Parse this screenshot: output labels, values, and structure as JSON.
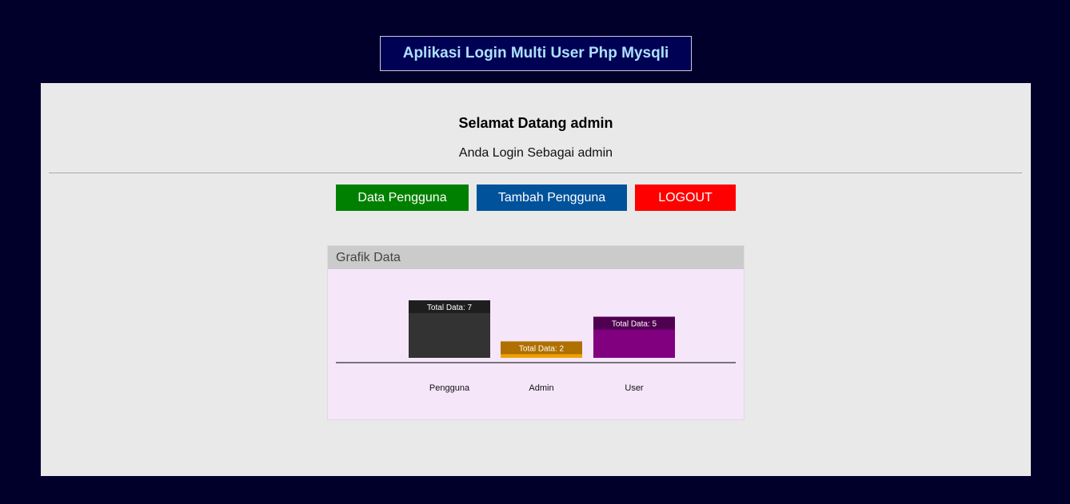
{
  "header": {
    "app_title": "Aplikasi Login Multi User Php Mysqli"
  },
  "main": {
    "welcome": "Selamat Datang admin",
    "role_line": "Anda Login Sebagai admin"
  },
  "nav": {
    "data_pengguna": "Data Pengguna",
    "tambah_pengguna": "Tambah Pengguna",
    "logout": "LOGOUT"
  },
  "colors": {
    "page_bg": "#00002a",
    "panel_bg": "#e9e9e9",
    "btn_data": "#008000",
    "btn_tambah": "#00529b",
    "btn_logout": "#ff0000"
  },
  "chart_card": {
    "title": "Grafik Data"
  },
  "chart_data": {
    "type": "bar",
    "title": "",
    "categories": [
      "Pengguna",
      "Admin",
      "User"
    ],
    "values": [
      7,
      2,
      5
    ],
    "data_labels": [
      "Total Data: 7",
      "Total Data: 2",
      "Total Data: 5"
    ],
    "colors": [
      "#333333",
      "#f0a000",
      "#800080"
    ],
    "label_colors": [
      "#1e1e1e",
      "#b07000",
      "#500050"
    ],
    "ylim": [
      0,
      7
    ],
    "grid": false,
    "legend": "none"
  }
}
